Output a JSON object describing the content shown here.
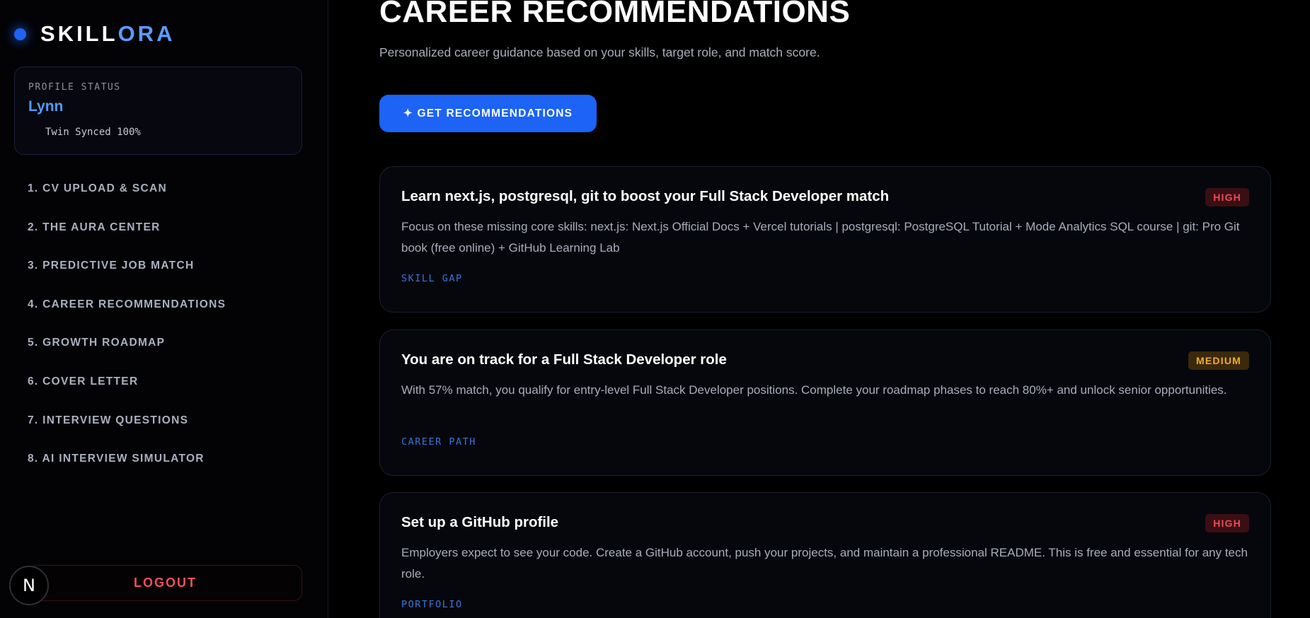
{
  "sidebar": {
    "brand": {
      "part1": "SKILL",
      "part2": "ORA"
    },
    "profile": {
      "label": "PROFILE STATUS",
      "name": "Lynn",
      "sync": "Twin Synced 100%"
    },
    "nav": [
      "1. CV UPLOAD & SCAN",
      "2. THE AURA CENTER",
      "3. PREDICTIVE JOB MATCH",
      "4. CAREER RECOMMENDATIONS",
      "5. GROWTH ROADMAP",
      "6. COVER LETTER",
      "7. INTERVIEW QUESTIONS",
      "8. AI INTERVIEW SIMULATOR"
    ],
    "logout_label": "LOGOUT",
    "badge_letter": "N"
  },
  "main": {
    "title": "CAREER RECOMMENDATIONS",
    "subtitle": "Personalized career guidance based on your skills, target role, and match score.",
    "cta_label": "✦ GET RECOMMENDATIONS",
    "recommendations": [
      {
        "title": "Learn next.js, postgresql, git to boost your Full Stack Developer match",
        "description": "Focus on these missing core skills: next.js: Next.js Official Docs + Vercel tutorials | postgresql: PostgreSQL Tutorial + Mode Analytics SQL course | git: Pro Git book (free online) + GitHub Learning Lab",
        "tag": "SKILL GAP",
        "priority": "HIGH"
      },
      {
        "title": "You are on track for a Full Stack Developer role",
        "description": "With 57% match, you qualify for entry-level Full Stack Developer positions. Complete your roadmap phases to reach 80%+ and unlock senior opportunities.",
        "tag": "CAREER PATH",
        "priority": "MEDIUM"
      },
      {
        "title": "Set up a GitHub profile",
        "description": "Employers expect to see your code. Create a GitHub account, push your projects, and maintain a professional README. This is free and essential for any tech role.",
        "tag": "PORTFOLIO",
        "priority": "HIGH"
      }
    ]
  },
  "colors": {
    "accent": "#1c63f6",
    "brand_light": "#5b9cff",
    "high": "#ef4b55",
    "medium": "#f3ab2b",
    "logout": "#f0525b"
  }
}
